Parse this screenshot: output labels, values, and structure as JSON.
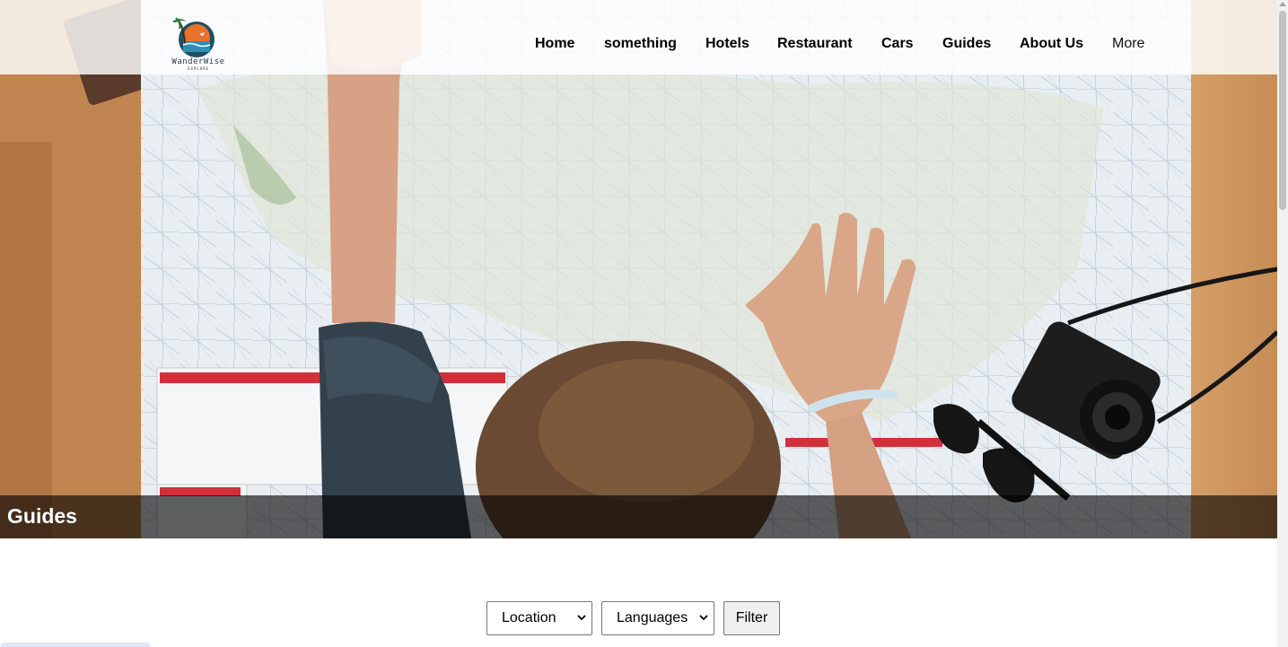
{
  "brand": {
    "name": "WanderWise",
    "tagline": "EXPLORE"
  },
  "nav": {
    "items": [
      {
        "label": "Home"
      },
      {
        "label": "something"
      },
      {
        "label": "Hotels"
      },
      {
        "label": "Restaurant"
      },
      {
        "label": "Cars"
      },
      {
        "label": "Guides"
      },
      {
        "label": "About Us"
      }
    ],
    "more_label": "More"
  },
  "hero": {
    "title": "Guides",
    "image_alt": "Person planning a trip over a map of the United States with sunglasses and a camera"
  },
  "filters": {
    "location": {
      "selected": "Location"
    },
    "languages": {
      "selected": "Languages"
    },
    "filter_button": "Filter"
  },
  "colors": {
    "header_bg": "#ffffff",
    "caption_bg": "#000000",
    "wood": "#c8905a",
    "map": "#e9eef2",
    "button_bg": "#efefef"
  }
}
